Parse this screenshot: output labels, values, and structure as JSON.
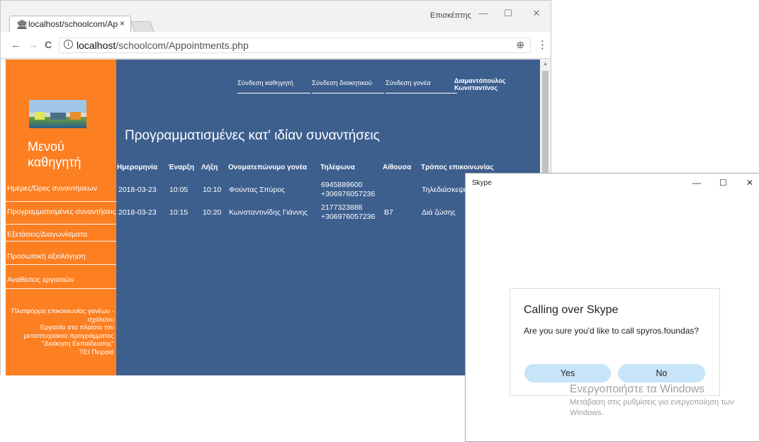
{
  "browser": {
    "tab_title": "localhost/schoolcom/Ap  ",
    "user_label": "Επισκέπτης",
    "window_buttons": {
      "minimize": "—",
      "maximize": "☐",
      "close": "✕"
    },
    "nav": {
      "back": "←",
      "forward": "→",
      "reload": "C"
    },
    "url_host": "localhost",
    "url_path": "/schoolcom/Appointments.php",
    "tab_close": "×",
    "favicon": "🏛",
    "zoom_icon": "⊕",
    "menu_icon": "⋮"
  },
  "sidebar": {
    "menu_title_line1": "Μενού",
    "menu_title_line2": "καθηγητή",
    "items": [
      {
        "label": "Ημέρες/Ώρες συναντήσεων"
      },
      {
        "label": "Προγραμματισμένες συναντήσεις"
      },
      {
        "label": "Εξετάσεις/Διαγωνίσματα"
      },
      {
        "label": "Προσωπική αξιολόγηση"
      },
      {
        "label": "Αναθέσεις εργασιών"
      }
    ],
    "footer_lines": [
      "Πλατφόρμα επικοινωνίας γονέων -",
      "σχολείου",
      "Εργασία στο πλαίσιο του",
      "μεταπτυχιακού προγράμματος",
      "\"Διοίκηση Εκπαίδευσης\"",
      "ΤΕΙ Πειραιά"
    ]
  },
  "topnav": {
    "links": [
      {
        "label": "Σύνδεση καθηγητή"
      },
      {
        "label": "Σύνδεση διοικητικού"
      },
      {
        "label": "Σύνδεση γονέα"
      }
    ],
    "user_line1": "Διαμαντόπουλος",
    "user_line2": "Κωνσταντίνος"
  },
  "main": {
    "title": "Προγραμματισμένες κατ' ιδίαν συναντήσεις",
    "columns": [
      "Ημερομηνία",
      "Έναρξη",
      "Λήξη",
      "Ονοματεπώνυμο γονέα",
      "Τηλέφωνα",
      "Αίθουσα",
      "Τρόπος επικοινωνίας"
    ],
    "rows": [
      {
        "date": "2018-03-23",
        "start": "10:05",
        "end": "10:10",
        "parent": "Φούντας Σπύρος",
        "phone1": "6945889600",
        "phone2": "+306976057236",
        "room": "",
        "mode": "Τηλεδιάσκεψη"
      },
      {
        "date": "2018-03-23",
        "start": "10:15",
        "end": "10:20",
        "parent": "Κωνσταντινίδης Γιάννης",
        "phone1": "2177323888",
        "phone2": "+306976057236",
        "room": "Β7",
        "mode": "Διά ζώσης"
      }
    ]
  },
  "skype": {
    "window_title": "Skype",
    "window_buttons": {
      "minimize": "—",
      "maximize": "☐",
      "close": "✕"
    },
    "heading": "Calling over Skype",
    "question": "Are you sure you'd like to call spyros.foundas?",
    "yes_label": "Yes",
    "no_label": "No"
  },
  "watermark": {
    "title": "Ενεργοποιήστε τα Windows",
    "subtitle": "Μετάβαση στις ρυθμίσεις για ενεργοποίηση των Windows."
  }
}
